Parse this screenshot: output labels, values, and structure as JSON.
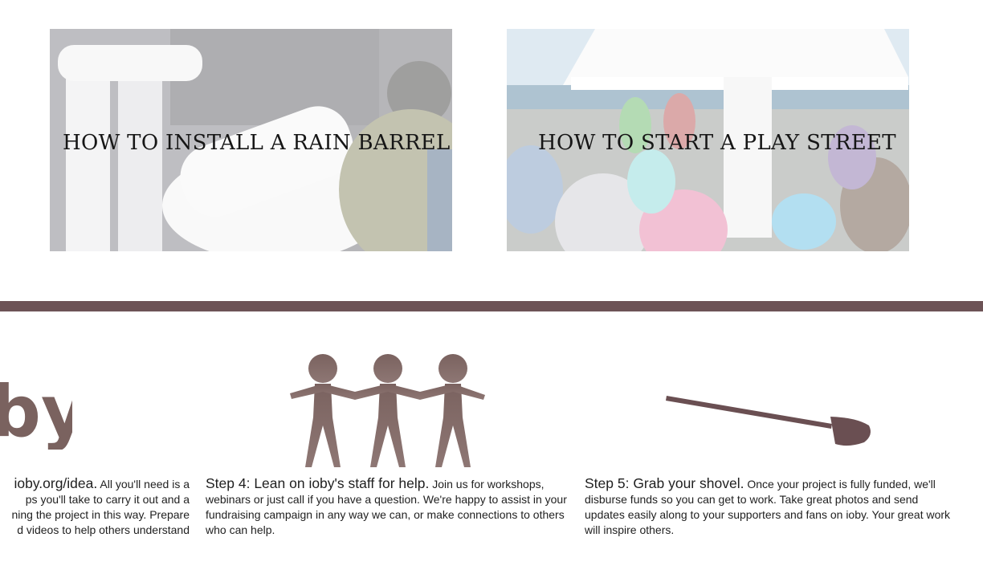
{
  "cards": [
    {
      "title": "HOW TO INSTALL A RAIN BARREL"
    },
    {
      "title": "HOW TO START A PLAY STREET"
    }
  ],
  "steps": [
    {
      "lead": "ioby.org/idea.",
      "body_lines": [
        "All you'll need is a",
        "ps you'll take to carry it out and a",
        "ning the project in this way. Prepare",
        "d videos to help others understand"
      ]
    },
    {
      "lead": "Step 4: Lean on ioby's staff for help.",
      "body": "Join us for workshops, webinars or just call if you have a question. We're happy to assist in your fundraising campaign in any way we can, or make connections to others who can help."
    },
    {
      "lead": "Step 5: Grab your shovel.",
      "body": "Once your project is fully funded, we'll disburse funds so you can get to work. Take great photos and send updates easily along to your supporters and fans on ioby. Your great work will inspire others."
    }
  ],
  "logo_text": "by",
  "colors": {
    "divider": "#6d5356",
    "icon_brown": "#7a625f",
    "shovel_brown": "#6a4f52"
  },
  "icons": [
    "people-holding-hands-icon",
    "shovel-icon"
  ]
}
